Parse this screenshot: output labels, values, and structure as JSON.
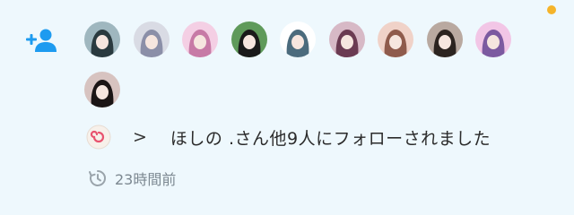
{
  "notification": {
    "icon": "person-add-icon",
    "unread": true,
    "accent_color": "#1d9bf0",
    "unread_color": "#f5b42a",
    "avatars": [
      {
        "name": "avatar-1",
        "colors": [
          "#9fb7bf",
          "#2a3a3f"
        ]
      },
      {
        "name": "avatar-2",
        "colors": [
          "#d9dbe4",
          "#8b8fa8"
        ]
      },
      {
        "name": "avatar-3",
        "colors": [
          "#f4cfe4",
          "#c77aa6"
        ]
      },
      {
        "name": "avatar-4",
        "colors": [
          "#5f9a5a",
          "#1a1a1a"
        ]
      },
      {
        "name": "avatar-5",
        "colors": [
          "#ffffff",
          "#4b6b7d"
        ]
      },
      {
        "name": "avatar-6",
        "colors": [
          "#d7b9c6",
          "#6b3b52"
        ]
      },
      {
        "name": "avatar-7",
        "colors": [
          "#f0d2c8",
          "#8f5b4c"
        ]
      },
      {
        "name": "avatar-8",
        "colors": [
          "#b9a9a0",
          "#2c2420"
        ]
      },
      {
        "name": "avatar-9",
        "colors": [
          "#f2c6e6",
          "#7c5aa0"
        ]
      },
      {
        "name": "avatar-10",
        "colors": [
          "#d7c3c0",
          "#1b1515"
        ]
      }
    ],
    "reaction_icon": "naruto-fishcake-emoji",
    "separator": ">",
    "message": "ほしの .さん他9人にフォローされました",
    "time_icon": "clock-history-icon",
    "time": "23時間前"
  }
}
